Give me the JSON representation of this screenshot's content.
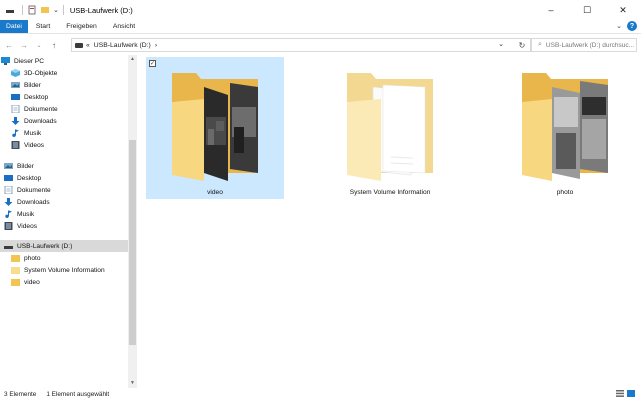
{
  "window": {
    "title": "USB-Laufwerk (D:)",
    "controls": {
      "minimize": "–",
      "maximize": "☐",
      "close": "✕"
    }
  },
  "ribbon": {
    "tabs": [
      "Datei",
      "Start",
      "Freigeben",
      "Ansicht"
    ],
    "active_tab": "Datei",
    "expand_icon": "chevron-down-icon",
    "help_label": "?"
  },
  "address_bar": {
    "back": "←",
    "forward": "→",
    "recent": "⌄",
    "up": "↑",
    "path_prefix": "«",
    "path": "USB-Laufwerk (D:)",
    "path_suffix": "›",
    "dropdown": "⌄",
    "refresh": "↻"
  },
  "search": {
    "placeholder": "USB-Laufwerk (D:) durchsuc..."
  },
  "sidebar": {
    "items": [
      {
        "label": "Dieser PC",
        "icon": "pc-icon"
      },
      {
        "label": "3D-Objekte",
        "icon": "3d-objects-icon"
      },
      {
        "label": "Bilder",
        "icon": "pictures-icon"
      },
      {
        "label": "Desktop",
        "icon": "desktop-icon"
      },
      {
        "label": "Dokumente",
        "icon": "documents-icon"
      },
      {
        "label": "Downloads",
        "icon": "downloads-icon"
      },
      {
        "label": "Musik",
        "icon": "music-icon"
      },
      {
        "label": "Videos",
        "icon": "videos-icon"
      },
      {
        "label": "Bilder",
        "icon": "pictures-icon"
      },
      {
        "label": "Desktop",
        "icon": "desktop-icon"
      },
      {
        "label": "Dokumente",
        "icon": "documents-icon"
      },
      {
        "label": "Downloads",
        "icon": "downloads-icon"
      },
      {
        "label": "Musik",
        "icon": "music-icon"
      },
      {
        "label": "Videos",
        "icon": "videos-icon"
      },
      {
        "label": "USB-Laufwerk (D:)",
        "icon": "usb-drive-icon",
        "selected": true
      },
      {
        "label": "photo",
        "icon": "folder-icon"
      },
      {
        "label": "System Volume Information",
        "icon": "folder-icon"
      },
      {
        "label": "video",
        "icon": "folder-icon"
      }
    ]
  },
  "content": {
    "folders": [
      {
        "name": "video",
        "selected": true,
        "preview": "dark-photos"
      },
      {
        "name": "System Volume Information",
        "selected": false,
        "preview": "documents"
      },
      {
        "name": "photo",
        "selected": false,
        "preview": "gray-photos"
      }
    ]
  },
  "status_bar": {
    "item_count": "3 Elemente",
    "selection": "1 Element ausgewählt"
  },
  "colors": {
    "accent": "#1979ca",
    "selection": "#cce8ff",
    "folder_back": "#e8b64a",
    "folder_front": "#f7d780",
    "nav_selected": "#d9d9d9"
  }
}
